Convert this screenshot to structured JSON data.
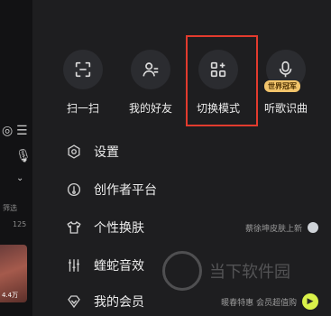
{
  "left_strip": {
    "icons": [
      "target-icon",
      "menu-icon",
      "mic-icon",
      "chevron-down-icon"
    ],
    "filter_text": "筛选",
    "count_text": "125",
    "thumb_label": "4.4万"
  },
  "quick_actions": [
    {
      "label": "扫一扫",
      "icon": "scan-icon"
    },
    {
      "label": "我的好友",
      "icon": "friends-icon"
    },
    {
      "label": "切换模式",
      "icon": "switch-mode-icon"
    },
    {
      "label": "听歌识曲",
      "icon": "music-recognize-icon",
      "badge": "世界冠军"
    }
  ],
  "menu": [
    {
      "label": "设置",
      "icon": "settings-icon"
    },
    {
      "label": "创作者平台",
      "icon": "creator-icon"
    },
    {
      "label": "个性换肤",
      "icon": "skin-icon",
      "extra": "蔡徐坤皮肤上新"
    },
    {
      "label": "蝰蛇音效",
      "icon": "equalizer-icon"
    },
    {
      "label": "我的会员",
      "icon": "vip-icon",
      "extra": "暖春特惠 会员超值购"
    }
  ],
  "watermark": {
    "text": "当下软件园"
  },
  "colors": {
    "highlight": "#e23b2e",
    "badge": "#f2c46b",
    "vip_arrow": "#d9f14a"
  }
}
